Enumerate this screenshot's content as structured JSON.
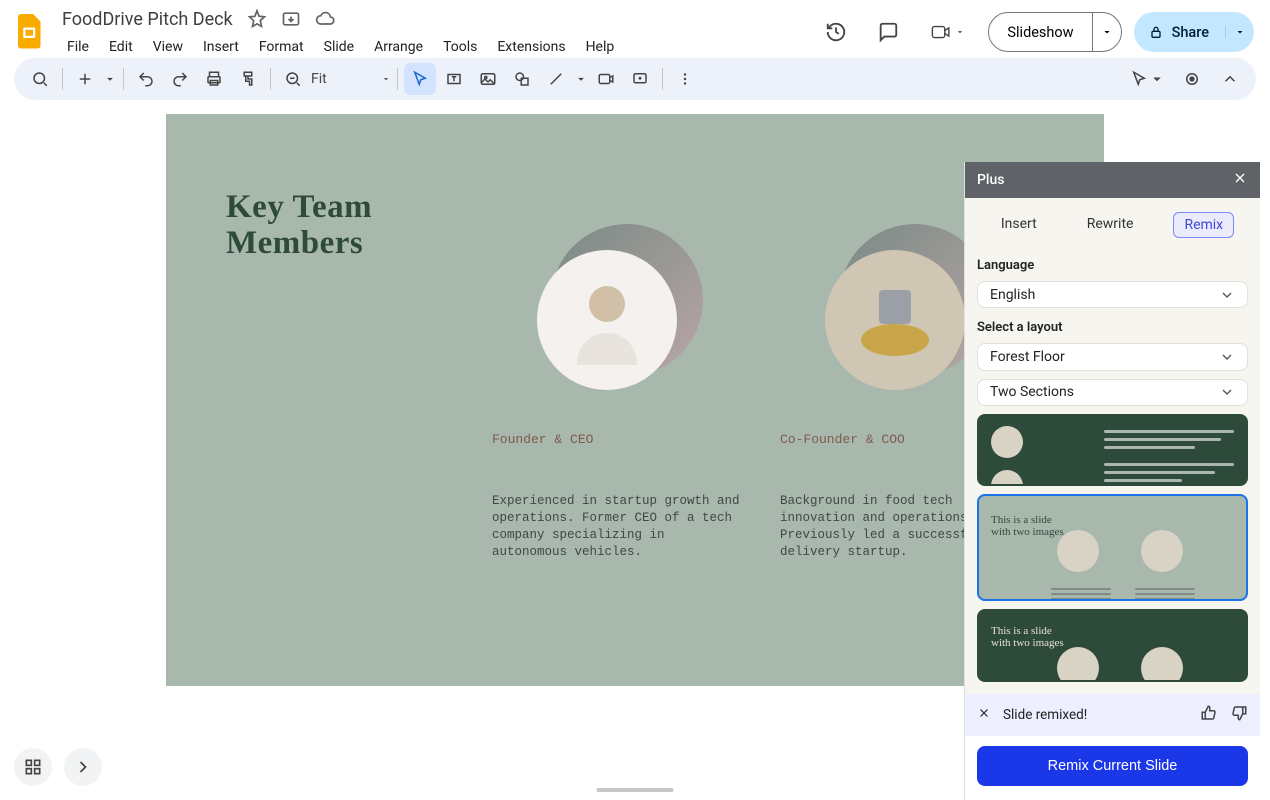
{
  "doc": {
    "title": "FoodDrive Pitch Deck"
  },
  "menus": [
    "File",
    "Edit",
    "View",
    "Insert",
    "Format",
    "Slide",
    "Arrange",
    "Tools",
    "Extensions",
    "Help"
  ],
  "toolbar": {
    "zoom_label": "Fit"
  },
  "top_right": {
    "slideshow_label": "Slideshow",
    "share_label": "Share"
  },
  "slide": {
    "title_line1": "Key Team",
    "title_line2": "Members",
    "members": [
      {
        "role": "Founder & CEO",
        "bio": "Experienced in startup growth and operations. Former CEO of a tech company specializing in autonomous vehicles."
      },
      {
        "role": "Co-Founder & COO",
        "bio": "Background in food tech innovation and operations. Previously led a successful food delivery startup."
      }
    ]
  },
  "plus": {
    "title": "Plus",
    "tabs": [
      "Insert",
      "Rewrite",
      "Remix"
    ],
    "active_tab": 2,
    "language_label": "Language",
    "language_value": "English",
    "layout_label": "Select a layout",
    "layout_value1": "Forest Floor",
    "layout_value2": "Two Sections",
    "thumb_caption": "This is a slide\nwith two images",
    "feedback_text": "Slide remixed!",
    "remix_button": "Remix Current Slide"
  }
}
